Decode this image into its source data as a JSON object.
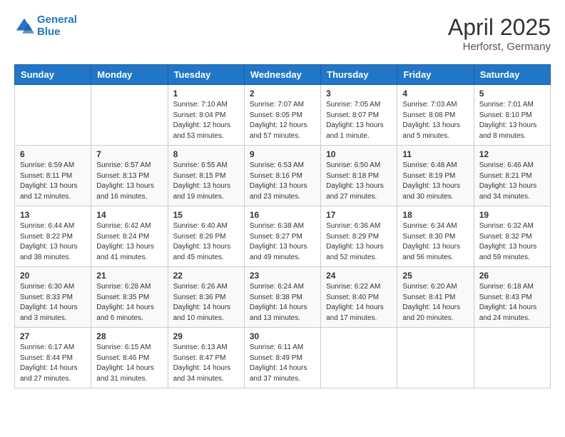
{
  "header": {
    "logo_line1": "General",
    "logo_line2": "Blue",
    "main_title": "April 2025",
    "subtitle": "Herforst, Germany"
  },
  "weekdays": [
    "Sunday",
    "Monday",
    "Tuesday",
    "Wednesday",
    "Thursday",
    "Friday",
    "Saturday"
  ],
  "weeks": [
    [
      {
        "day": "",
        "info": ""
      },
      {
        "day": "",
        "info": ""
      },
      {
        "day": "1",
        "info": "Sunrise: 7:10 AM\nSunset: 8:04 PM\nDaylight: 12 hours and 53 minutes."
      },
      {
        "day": "2",
        "info": "Sunrise: 7:07 AM\nSunset: 8:05 PM\nDaylight: 12 hours and 57 minutes."
      },
      {
        "day": "3",
        "info": "Sunrise: 7:05 AM\nSunset: 8:07 PM\nDaylight: 13 hours and 1 minute."
      },
      {
        "day": "4",
        "info": "Sunrise: 7:03 AM\nSunset: 8:08 PM\nDaylight: 13 hours and 5 minutes."
      },
      {
        "day": "5",
        "info": "Sunrise: 7:01 AM\nSunset: 8:10 PM\nDaylight: 13 hours and 8 minutes."
      }
    ],
    [
      {
        "day": "6",
        "info": "Sunrise: 6:59 AM\nSunset: 8:11 PM\nDaylight: 13 hours and 12 minutes."
      },
      {
        "day": "7",
        "info": "Sunrise: 6:57 AM\nSunset: 8:13 PM\nDaylight: 13 hours and 16 minutes."
      },
      {
        "day": "8",
        "info": "Sunrise: 6:55 AM\nSunset: 8:15 PM\nDaylight: 13 hours and 19 minutes."
      },
      {
        "day": "9",
        "info": "Sunrise: 6:53 AM\nSunset: 8:16 PM\nDaylight: 13 hours and 23 minutes."
      },
      {
        "day": "10",
        "info": "Sunrise: 6:50 AM\nSunset: 8:18 PM\nDaylight: 13 hours and 27 minutes."
      },
      {
        "day": "11",
        "info": "Sunrise: 6:48 AM\nSunset: 8:19 PM\nDaylight: 13 hours and 30 minutes."
      },
      {
        "day": "12",
        "info": "Sunrise: 6:46 AM\nSunset: 8:21 PM\nDaylight: 13 hours and 34 minutes."
      }
    ],
    [
      {
        "day": "13",
        "info": "Sunrise: 6:44 AM\nSunset: 8:22 PM\nDaylight: 13 hours and 38 minutes."
      },
      {
        "day": "14",
        "info": "Sunrise: 6:42 AM\nSunset: 8:24 PM\nDaylight: 13 hours and 41 minutes."
      },
      {
        "day": "15",
        "info": "Sunrise: 6:40 AM\nSunset: 8:26 PM\nDaylight: 13 hours and 45 minutes."
      },
      {
        "day": "16",
        "info": "Sunrise: 6:38 AM\nSunset: 8:27 PM\nDaylight: 13 hours and 49 minutes."
      },
      {
        "day": "17",
        "info": "Sunrise: 6:36 AM\nSunset: 8:29 PM\nDaylight: 13 hours and 52 minutes."
      },
      {
        "day": "18",
        "info": "Sunrise: 6:34 AM\nSunset: 8:30 PM\nDaylight: 13 hours and 56 minutes."
      },
      {
        "day": "19",
        "info": "Sunrise: 6:32 AM\nSunset: 8:32 PM\nDaylight: 13 hours and 59 minutes."
      }
    ],
    [
      {
        "day": "20",
        "info": "Sunrise: 6:30 AM\nSunset: 8:33 PM\nDaylight: 14 hours and 3 minutes."
      },
      {
        "day": "21",
        "info": "Sunrise: 6:28 AM\nSunset: 8:35 PM\nDaylight: 14 hours and 6 minutes."
      },
      {
        "day": "22",
        "info": "Sunrise: 6:26 AM\nSunset: 8:36 PM\nDaylight: 14 hours and 10 minutes."
      },
      {
        "day": "23",
        "info": "Sunrise: 6:24 AM\nSunset: 8:38 PM\nDaylight: 14 hours and 13 minutes."
      },
      {
        "day": "24",
        "info": "Sunrise: 6:22 AM\nSunset: 8:40 PM\nDaylight: 14 hours and 17 minutes."
      },
      {
        "day": "25",
        "info": "Sunrise: 6:20 AM\nSunset: 8:41 PM\nDaylight: 14 hours and 20 minutes."
      },
      {
        "day": "26",
        "info": "Sunrise: 6:18 AM\nSunset: 8:43 PM\nDaylight: 14 hours and 24 minutes."
      }
    ],
    [
      {
        "day": "27",
        "info": "Sunrise: 6:17 AM\nSunset: 8:44 PM\nDaylight: 14 hours and 27 minutes."
      },
      {
        "day": "28",
        "info": "Sunrise: 6:15 AM\nSunset: 8:46 PM\nDaylight: 14 hours and 31 minutes."
      },
      {
        "day": "29",
        "info": "Sunrise: 6:13 AM\nSunset: 8:47 PM\nDaylight: 14 hours and 34 minutes."
      },
      {
        "day": "30",
        "info": "Sunrise: 6:11 AM\nSunset: 8:49 PM\nDaylight: 14 hours and 37 minutes."
      },
      {
        "day": "",
        "info": ""
      },
      {
        "day": "",
        "info": ""
      },
      {
        "day": "",
        "info": ""
      }
    ]
  ]
}
